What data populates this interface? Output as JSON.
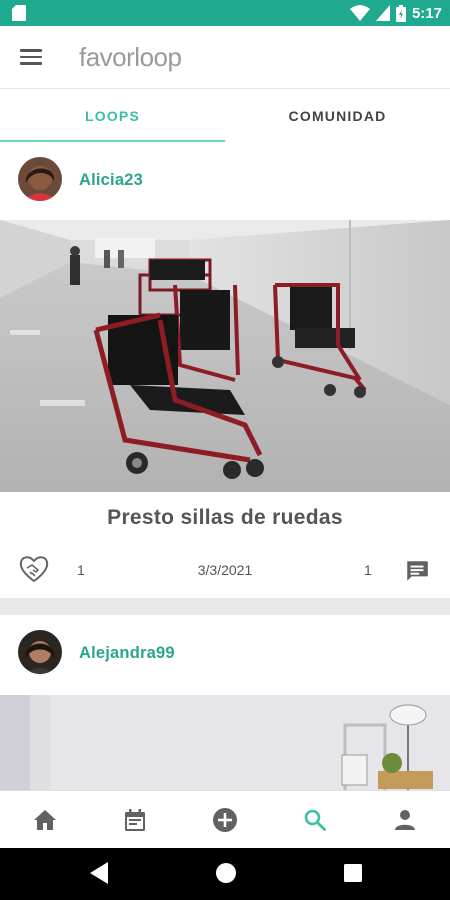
{
  "status_bar": {
    "time": "5:17",
    "background": "#1fa98e"
  },
  "app_bar": {
    "logo_text": "favorloop",
    "menu_icon": "hamburger-menu-icon"
  },
  "tabs": [
    {
      "label": "LOOPS",
      "active": true
    },
    {
      "label": "COMUNIDAD",
      "active": false
    }
  ],
  "posts": [
    {
      "username": "Alicia23",
      "title": "Presto sillas de ruedas",
      "likes": "1",
      "date": "3/3/2021",
      "comments": "1"
    },
    {
      "username": "Alejandra99"
    }
  ],
  "bottom_nav": [
    {
      "icon": "home-icon",
      "active": false
    },
    {
      "icon": "calendar-icon",
      "active": false
    },
    {
      "icon": "add-circle-icon",
      "active": false
    },
    {
      "icon": "search-icon",
      "active": true
    },
    {
      "icon": "person-icon",
      "active": false
    }
  ],
  "colors": {
    "accent": "#39c1a5",
    "username": "#2aa68d",
    "status_bar": "#1fa98e",
    "icon_gray": "#616161"
  }
}
